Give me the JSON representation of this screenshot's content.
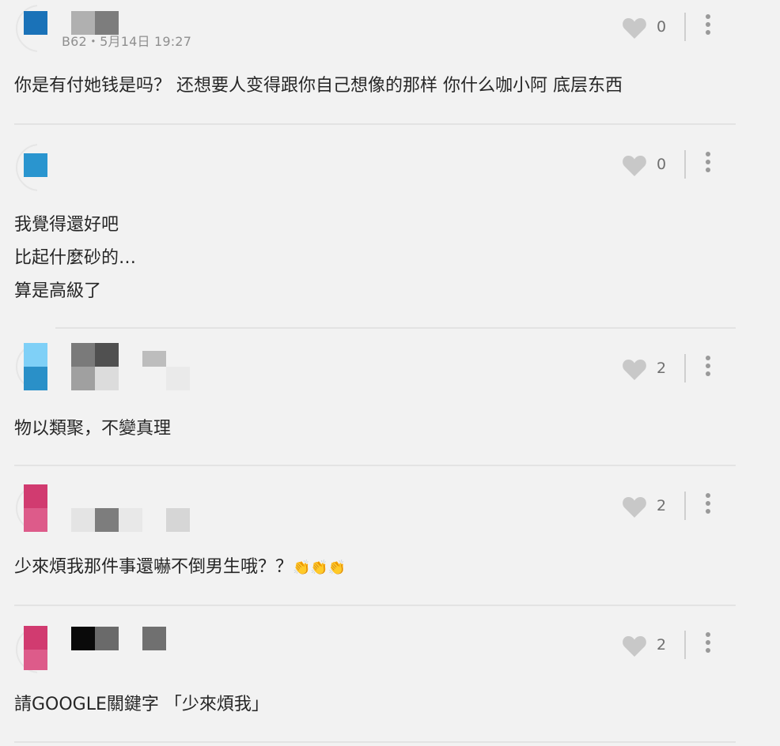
{
  "comments": [
    {
      "meta": "B62・5月14日 19:27",
      "likes": "0",
      "text": "你是有付她钱是吗？ 还想要人变得跟你自己想像的那样 你什么咖小阿 底层东西",
      "avatar_color": "#1a72b8"
    },
    {
      "meta": "",
      "likes": "0",
      "lines": [
        "我覺得還好吧",
        "比起什麼砂的…",
        "算是高級了"
      ],
      "avatar_color": "#2a95cf"
    },
    {
      "meta": "",
      "likes": "2",
      "text": "物以類聚，不變真理",
      "avatar_color": "#56bdf0"
    },
    {
      "meta": "",
      "likes": "2",
      "text": "少來煩我那件事還嚇不倒男生哦？？",
      "emoji": "👏👏👏",
      "avatar_color": "#d13b70"
    },
    {
      "meta": "",
      "likes": "2",
      "text": "請GOOGLE關鍵字 「少來煩我」",
      "avatar_color": "#d13b70"
    }
  ],
  "icons": {
    "like": "heart-icon",
    "more": "more-vertical-icon"
  },
  "colors": {
    "background": "#f2f2f2",
    "heart": "#c8c8c8",
    "divider": "#e3e3e3"
  }
}
